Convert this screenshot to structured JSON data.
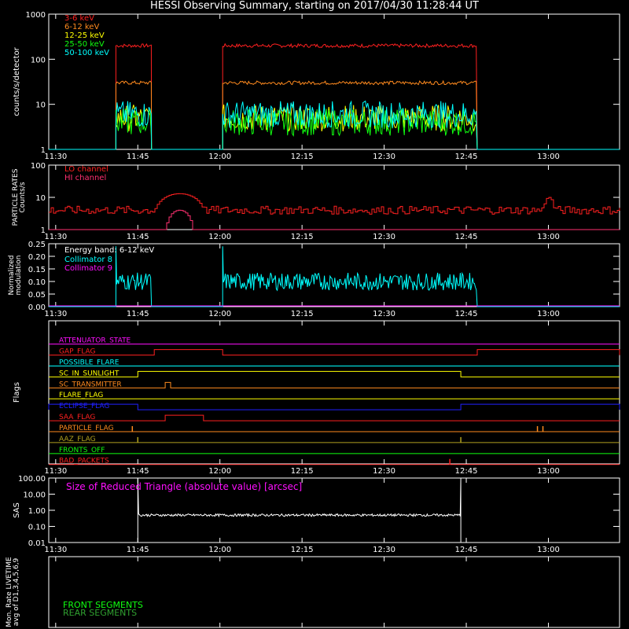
{
  "title": "HESSI Observing Summary, starting on 2017/04/30 11:28:44 UT",
  "time_ticks": [
    "11:30",
    "11:45",
    "12:00",
    "12:15",
    "12:30",
    "12:45",
    "13:00"
  ],
  "colors": {
    "red": "#ff2020",
    "orange": "#ff8a1e",
    "yellow": "#ffff00",
    "green": "#10ff10",
    "cyan": "#00ffff",
    "magenta": "#ff10ff",
    "blue": "#2020ff",
    "olive": "#b0a020",
    "white": "#ffffff",
    "darkgreen": "#30a030",
    "pinkred": "#ff3070"
  },
  "chart_data": [
    {
      "id": "rates",
      "type": "line",
      "ylabel": "counts/s/detector",
      "yscale": "log",
      "ylim": [
        1,
        1000
      ],
      "yticks": [
        "1",
        "10",
        "100",
        "1000"
      ],
      "xlim": [
        "11:28:44",
        "13:13:00"
      ],
      "legend": [
        {
          "name": "3-6 keV",
          "color": "#ff2020"
        },
        {
          "name": "6-12 keV",
          "color": "#ff8a1e"
        },
        {
          "name": "12-25 keV",
          "color": "#ffff00"
        },
        {
          "name": "25-50 keV",
          "color": "#10ff10"
        },
        {
          "name": "50-100 keV",
          "color": "#00ffff"
        }
      ],
      "series": [
        {
          "name": "3-6 keV",
          "color": "#ff2020",
          "segments": [
            [
              "11:41:00",
              "11:47:30",
              200
            ],
            [
              "12:00:30",
              "12:47:00",
              200
            ]
          ],
          "base": 1
        },
        {
          "name": "6-12 keV",
          "color": "#ff8a1e",
          "segments": [
            [
              "11:41:00",
              "11:47:30",
              30
            ],
            [
              "12:00:30",
              "12:47:00",
              30
            ]
          ],
          "base": 1
        },
        {
          "name": "12-25 keV",
          "color": "#ffff00",
          "segments": [
            [
              "11:41:00",
              "11:47:30",
              5
            ],
            [
              "12:00:30",
              "12:47:00",
              5
            ]
          ],
          "base": 1
        },
        {
          "name": "25-50 keV",
          "color": "#10ff10",
          "segments": [
            [
              "11:41:00",
              "11:47:30",
              4
            ],
            [
              "12:00:30",
              "12:47:00",
              4
            ]
          ],
          "base": 1
        },
        {
          "name": "50-100 keV",
          "color": "#00ffff",
          "segments": [
            [
              "11:41:00",
              "11:47:30",
              6
            ],
            [
              "12:00:30",
              "12:47:00",
              6
            ]
          ],
          "base": 1
        }
      ]
    },
    {
      "id": "particle",
      "type": "line",
      "ylabel": "PARTICLE RATES Counts/s",
      "yscale": "log",
      "ylim": [
        1,
        100
      ],
      "yticks": [
        "1",
        "10",
        "100"
      ],
      "legend": [
        {
          "name": "LO channel",
          "color": "#ff2020"
        },
        {
          "name": "HI channel",
          "color": "#ff3070"
        }
      ],
      "series": [
        {
          "name": "LO channel",
          "color": "#ff2020",
          "baseline": 4,
          "bumps": [
            [
              "11:48:00",
              "11:57:00",
              13
            ],
            [
              "12:59:00",
              "13:01:00",
              10
            ]
          ]
        },
        {
          "name": "HI channel",
          "color": "#ff3070",
          "baseline": 1,
          "bumps": [
            [
              "11:50:00",
              "11:55:00",
              4
            ]
          ]
        }
      ]
    },
    {
      "id": "modulation",
      "type": "line",
      "ylabel": "Normalized modulation",
      "ylim": [
        0,
        0.25
      ],
      "yticks": [
        "0.00",
        "0.05",
        "0.10",
        "0.15",
        "0.20",
        "0.25"
      ],
      "annotation": "Energy band: 6-12 keV",
      "legend": [
        {
          "name": "Collimator 8",
          "color": "#00ffff"
        },
        {
          "name": "Collimator 9",
          "color": "#ff10ff"
        }
      ],
      "series": [
        {
          "name": "Collimator 8",
          "color": "#00ffff",
          "segments": [
            [
              "11:41:00",
              "11:47:30",
              0.1
            ],
            [
              "12:00:30",
              "12:47:00",
              0.1
            ]
          ]
        },
        {
          "name": "Collimator 9",
          "color": "#ff10ff",
          "value": 0
        }
      ]
    },
    {
      "id": "flags",
      "type": "line",
      "ylabel": "Flags",
      "flags": [
        {
          "name": "ATTENUATOR_STATE",
          "color": "#ff10ff",
          "steps": []
        },
        {
          "name": "GAP_FLAG",
          "color": "#ff2020",
          "steps": [
            [
              "11:48:00",
              "12:00:30"
            ],
            [
              "12:47:00",
              "13:13:00"
            ]
          ]
        },
        {
          "name": "POSSIBLE_FLARE",
          "color": "#00ffff",
          "steps": []
        },
        {
          "name": "SC_IN_SUNLIGHT",
          "color": "#ffff00",
          "steps": [
            [
              "11:45:00",
              "12:44:00"
            ]
          ]
        },
        {
          "name": "SC_TRANSMITTER",
          "color": "#ff8a1e",
          "steps": [
            [
              "11:50:00",
              "11:51:00"
            ]
          ]
        },
        {
          "name": "FLARE_FLAG",
          "color": "#ffff00",
          "steps": []
        },
        {
          "name": "ECLIPSE_FLAG",
          "color": "#2020ff",
          "steps": [
            [
              "11:28:44",
              "11:45:00"
            ],
            [
              "12:44:00",
              "13:13:00"
            ]
          ]
        },
        {
          "name": "SAA_FLAG",
          "color": "#ff2020",
          "steps": [
            [
              "11:50:00",
              "11:57:00"
            ]
          ]
        },
        {
          "name": "PARTICLE_FLAG",
          "color": "#ff8a1e",
          "spikes": [
            "11:44:00",
            "12:58:00",
            "12:59:00"
          ]
        },
        {
          "name": "AAZ_FLAG",
          "color": "#b0a020",
          "spikes": [
            "11:45:00",
            "12:44:00"
          ]
        },
        {
          "name": "FRONTS_OFF",
          "color": "#10ff10",
          "steps": []
        },
        {
          "name": "BAD_PACKETS",
          "color": "#ff2020",
          "spikes": [
            "12:42:00"
          ]
        }
      ]
    },
    {
      "id": "sas",
      "type": "line",
      "ylabel": "SAS",
      "yscale": "log",
      "ylim": [
        0.01,
        100
      ],
      "yticks": [
        "0.01",
        "0.10",
        "1.00",
        "10.00",
        "100.00"
      ],
      "annotation": "Size of Reduced Triangle (absolute value) [arcsec]",
      "series": [
        {
          "name": "Size of Reduced Triangle",
          "color": "#ffffff",
          "range": [
            "11:45:00",
            "12:44:00"
          ],
          "value": 0.5,
          "edge_spikes": 100
        }
      ]
    },
    {
      "id": "livetime",
      "type": "line",
      "ylabel": "Mon. Rate LIVETIME avg of D1,3,4,5,6,9",
      "legend": [
        {
          "name": "FRONT SEGMENTS",
          "color": "#10ff10"
        },
        {
          "name": "REAR SEGMENTS",
          "color": "#30a030"
        }
      ],
      "series": []
    }
  ]
}
